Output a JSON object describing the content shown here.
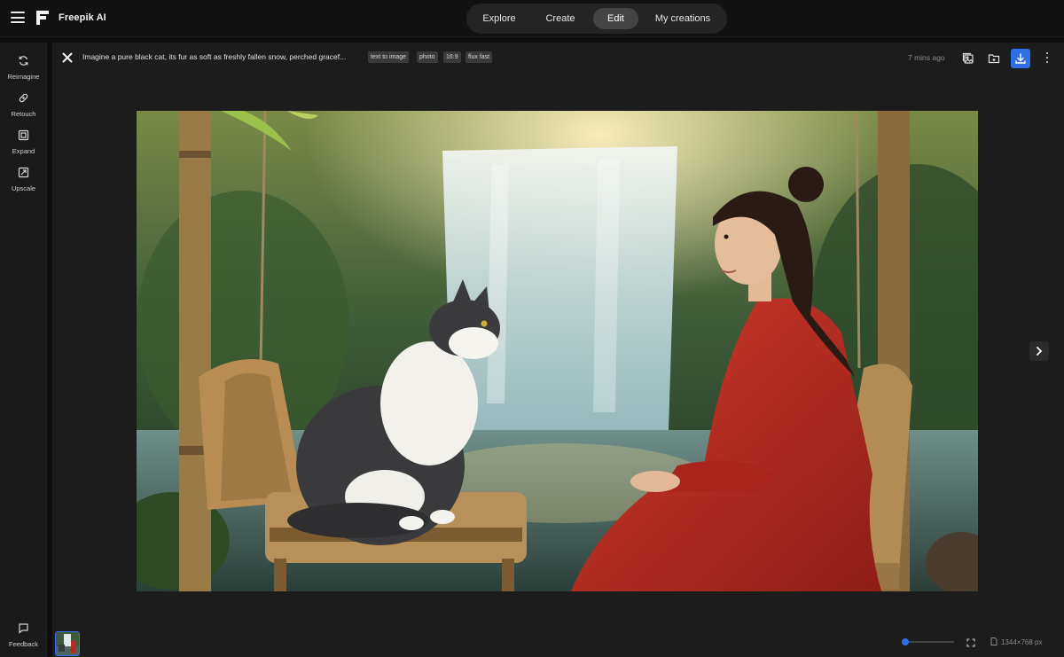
{
  "app": {
    "brand": "Freepik AI"
  },
  "nav": {
    "tabs": [
      {
        "label": "Explore",
        "active": false
      },
      {
        "label": "Create",
        "active": false
      },
      {
        "label": "Edit",
        "active": true
      },
      {
        "label": "My creations",
        "active": false
      }
    ]
  },
  "sidebar": {
    "items": [
      {
        "label": "Reimagine",
        "icon": "refresh-icon"
      },
      {
        "label": "Retouch",
        "icon": "bandage-icon"
      },
      {
        "label": "Expand",
        "icon": "expand-icon"
      },
      {
        "label": "Upscale",
        "icon": "upscale-icon"
      }
    ],
    "feedback_label": "Feedback"
  },
  "header": {
    "prompt": "Imagine a pure black cat, its fur as soft as freshly fallen snow, perched gracef...",
    "tags": [
      "text to image",
      "photo",
      "16:9",
      "flux fast"
    ],
    "time_ago": "7 mins ago"
  },
  "footer": {
    "dimensions": "1344×768 px",
    "zoom_level": 0
  },
  "colors": {
    "accent": "#2f6fe6",
    "background": "#1c1c1c",
    "topbar": "#111111"
  }
}
